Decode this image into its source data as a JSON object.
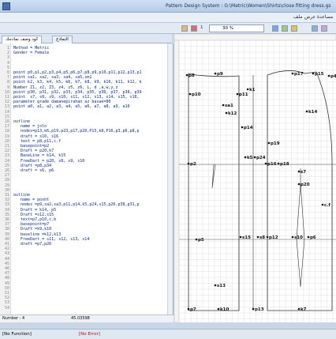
{
  "window": {
    "title": "Pattern Design System : G:\\Metric\\Women\\Shirts\\close fitting dress.gsl"
  },
  "menubar": {
    "items": [
      "ملف",
      "عرض",
      "مساعدة"
    ]
  },
  "toolbar": {
    "zoom_value": "30 %",
    "page_label": "1"
  },
  "tabs": [
    {
      "label": "كود وصف نماذجك"
    },
    {
      "label": "النماذج"
    }
  ],
  "editor": {
    "lines": [
      {
        "n": "1",
        "text": "Method = Metric"
      },
      {
        "n": "2",
        "text": "Gender = Female"
      },
      {
        "n": "3",
        "text": ""
      },
      {
        "n": "4",
        "text": ""
      },
      {
        "n": "5",
        "text": ""
      },
      {
        "n": "6",
        "text": "point p0,p1,p2,p3,p4,p5,p6,p7,p8,p9,p10,p11,p12,p13,p1"
      },
      {
        "n": "7",
        "text": "point sa1, sa2, sa3, sa4, sa5,sm1"
      },
      {
        "n": "8",
        "text": "point k2, k3, k4, k5, k6, k7, k8, k9, k10, k11, k12, k"
      },
      {
        "n": "9",
        "text": "Number Z1, z2, Z3, z4, z5, z6, L, d ,a,w,y,z"
      },
      {
        "n": "10",
        "text": "point p30, p31, p32, p33, p34, p35, p36, p37, p38, p39"
      },
      {
        "n": "11",
        "text": "point  s7, s8, s9, s10, s11, s12, s13, s14, s15, s16,"
      },
      {
        "n": "12",
        "text": "parameter grade damanepirahan az basae=80"
      },
      {
        "n": "13",
        "text": "point a0, a1, a2, a3, a4, a5, a6, a7, a8, a9, a10"
      },
      {
        "n": "14",
        "text": ""
      },
      {
        "n": "15",
        "text": ""
      },
      {
        "n": "16",
        "text": "outline"
      },
      {
        "n": "17",
        "text": "   name = jolo"
      },
      {
        "n": "18",
        "text": "   nodes=p13,k6,p19,p23,p17,p20,P15,k8,P16,p3,p6,p8,p"
      },
      {
        "n": "19",
        "text": "   draft = s10, s16"
      },
      {
        "n": "20",
        "text": "   text = p8,p11,c.f"
      },
      {
        "n": "21",
        "text": "   basepoint=p2"
      },
      {
        "n": "22",
        "text": "   Draft = p20,k7"
      },
      {
        "n": "23",
        "text": "   BaseLine = k14, k15"
      },
      {
        "n": "24",
        "text": "   FreeDart = p20, s8, s9, s10"
      },
      {
        "n": "25",
        "text": "   draft =p8,p34"
      },
      {
        "n": "26",
        "text": "   draft = s6, p6"
      },
      {
        "n": "27",
        "text": ""
      },
      {
        "n": "28",
        "text": ""
      },
      {
        "n": "29",
        "text": ""
      },
      {
        "n": "30",
        "text": ""
      },
      {
        "n": "31",
        "text": "outline"
      },
      {
        "n": "32",
        "text": "   name = posht"
      },
      {
        "n": "33",
        "text": "   nodes =p9,sa2,sa3,p11,p14,k5,p24,s15,p26,p38,p31,p"
      },
      {
        "n": "34",
        "text": "   Draft = k14, p5"
      },
      {
        "n": "35",
        "text": "   Draft =s12,s15"
      },
      {
        "n": "36",
        "text": "   text=p7,p10,c.b"
      },
      {
        "n": "37",
        "text": "   basepoint=p7"
      },
      {
        "n": "38",
        "text": "   Draft =k9,k10"
      },
      {
        "n": "39",
        "text": "   baseline =k12,k13"
      },
      {
        "n": "40",
        "text": "   FreeDart = s11, s12, s13, s14"
      },
      {
        "n": "41",
        "text": "   draft =p7,p26"
      },
      {
        "n": "42",
        "text": ""
      },
      {
        "n": "43",
        "text": ""
      },
      {
        "n": "44",
        "text": ""
      },
      {
        "n": "45",
        "text": ""
      },
      {
        "n": "46",
        "text": ""
      },
      {
        "n": "47",
        "text": ""
      },
      {
        "n": "48",
        "text": ""
      },
      {
        "n": "49",
        "text": ""
      },
      {
        "n": "50",
        "text": ""
      },
      {
        "n": "51",
        "text": ""
      },
      {
        "n": "52",
        "text": ""
      },
      {
        "n": "53",
        "text": ""
      },
      {
        "n": "54",
        "text": ""
      }
    ]
  },
  "editor_status": {
    "number_label": "Number : 4",
    "value": "45.03598"
  },
  "status": {
    "function": "[No Function]",
    "error": "[No Error]"
  },
  "canvas": {
    "points": [
      {
        "label": "p8"
      },
      {
        "label": "p9"
      },
      {
        "label": "p10"
      },
      {
        "label": "p17"
      },
      {
        "label": "p15"
      },
      {
        "label": "p4"
      },
      {
        "label": "p11"
      },
      {
        "label": "k1"
      },
      {
        "label": "sa1"
      },
      {
        "label": "k12"
      },
      {
        "label": "k14"
      },
      {
        "label": "p14"
      },
      {
        "label": "p19"
      },
      {
        "label": "k5"
      },
      {
        "label": "p2"
      },
      {
        "label": "p24"
      },
      {
        "label": "p16"
      },
      {
        "label": "p18"
      },
      {
        "label": "s7"
      },
      {
        "label": "p20"
      },
      {
        "label": "p5"
      },
      {
        "label": "s8"
      },
      {
        "label": "s10"
      },
      {
        "label": "p6"
      },
      {
        "label": "s13"
      },
      {
        "label": "p7"
      },
      {
        "label": "k10"
      },
      {
        "label": "k7"
      },
      {
        "label": "c.f"
      },
      {
        "label": "s15"
      },
      {
        "label": "p12"
      },
      {
        "label": "p13"
      }
    ]
  },
  "colors": {
    "accent": "#1a1a9a",
    "grid": "#d8d8d8",
    "canvas_bg": "#ffffff"
  }
}
